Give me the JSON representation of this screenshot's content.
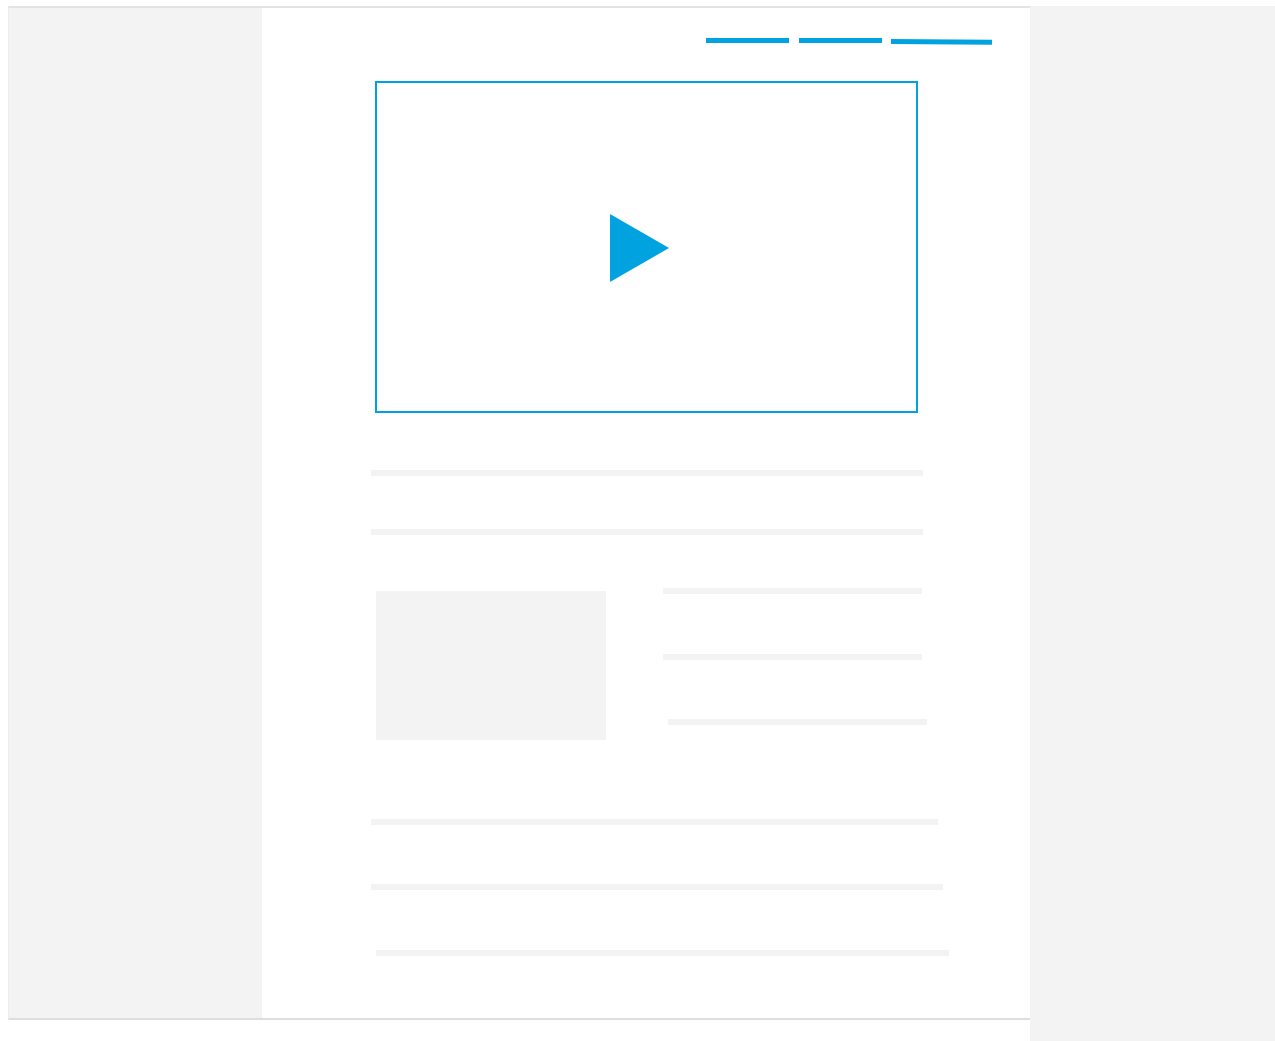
{
  "colors": {
    "accent": "#00a3df",
    "placeholder": "#f3f3f3",
    "panel": "#f3f3f3",
    "background": "#ffffff"
  },
  "nav": {
    "items": [
      {
        "id": "nav-item-1"
      },
      {
        "id": "nav-item-2"
      },
      {
        "id": "nav-item-3"
      }
    ]
  },
  "media": {
    "icon": "play-icon"
  },
  "content": {
    "text_lines": 8,
    "image_placeholders": 1
  }
}
